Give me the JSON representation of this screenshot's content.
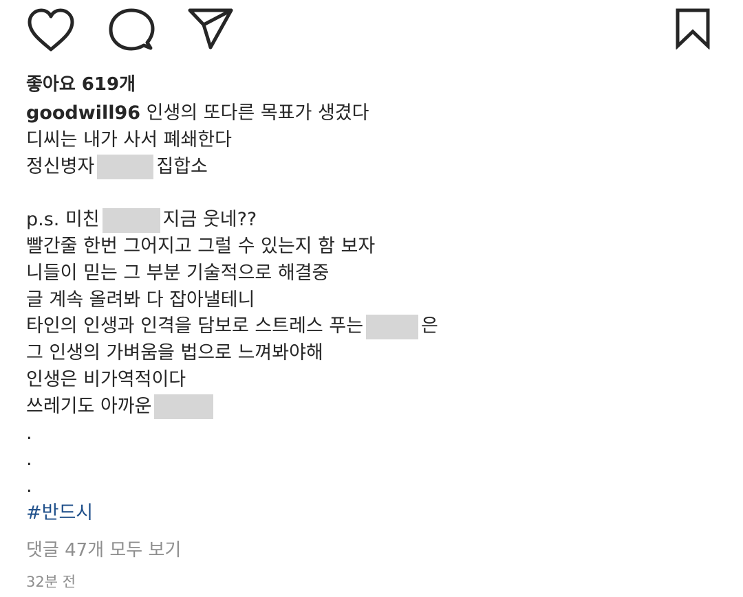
{
  "actions": {
    "like_icon": "heart-icon",
    "comment_icon": "comment-bubble-icon",
    "share_icon": "paper-plane-icon",
    "save_icon": "bookmark-icon"
  },
  "likes": "좋아요 619개",
  "caption": {
    "username": "goodwill96",
    "lines": [
      "인생의 또다른 목표가 생겼다",
      "디씨는 내가 사서 폐쇄한다",
      "정신병자",
      "집합소",
      "",
      "p.s. 미친",
      "지금 웃네??",
      "빨간줄 한번 그어지고 그럴 수 있는지 함 보자",
      "니들이 믿는 그 부분 기술적으로 해결중",
      "글 계속 올려봐 다 잡아낼테니",
      "타인의 인생과 인격을 담보로 스트레스 푸는",
      "은",
      "그 인생의 가벼움을 법으로 느껴봐야해",
      "인생은 비가역적이다",
      "쓰레기도 아까운",
      ".",
      ".",
      "."
    ],
    "hashtag": "#반드시"
  },
  "view_comments": "댓글 47개 모두 보기",
  "timestamp": "32분 전",
  "colors": {
    "text": "#262626",
    "muted": "#8e8e8e",
    "hashtag": "#1e4f8a",
    "redaction": "#d6d6d6"
  }
}
